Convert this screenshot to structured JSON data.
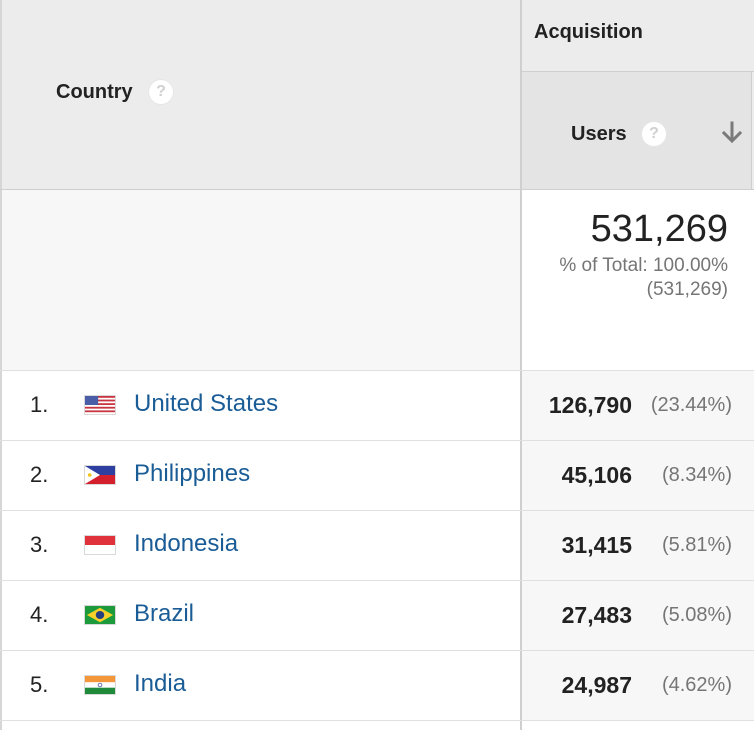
{
  "header": {
    "country_label": "Country",
    "group_label": "Acquisition",
    "users_label": "Users",
    "help_glyph": "?",
    "sort_icon": "arrow-down-icon"
  },
  "totals": {
    "value": "531,269",
    "pct_line": "% of Total: 100.00%",
    "pct_abs": "(531,269)"
  },
  "rows": [
    {
      "rank": "1.",
      "country": "United States",
      "users": "126,790",
      "pct": "(23.44%)",
      "flag": "us-flag-icon"
    },
    {
      "rank": "2.",
      "country": "Philippines",
      "users": "45,106",
      "pct": "(8.34%)",
      "flag": "ph-flag-icon"
    },
    {
      "rank": "3.",
      "country": "Indonesia",
      "users": "31,415",
      "pct": "(5.81%)",
      "flag": "id-flag-icon"
    },
    {
      "rank": "4.",
      "country": "Brazil",
      "users": "27,483",
      "pct": "(5.08%)",
      "flag": "br-flag-icon"
    },
    {
      "rank": "5.",
      "country": "India",
      "users": "24,987",
      "pct": "(4.62%)",
      "flag": "in-flag-icon"
    }
  ],
  "colors": {
    "link": "#1a5c96",
    "header_bg": "#ececec",
    "muted_text": "#757575"
  }
}
